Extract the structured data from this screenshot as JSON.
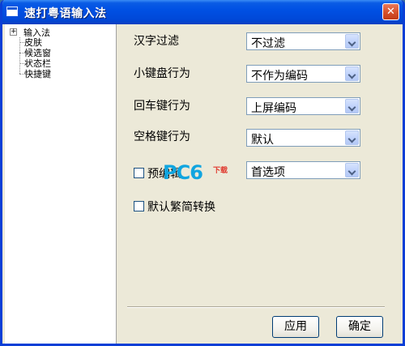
{
  "window": {
    "title": "速打粤语输入法",
    "close_glyph": "✕"
  },
  "tree": {
    "root": {
      "label": "输入法",
      "expander": "+"
    },
    "children": [
      "皮肤",
      "候选窗",
      "状态栏",
      "快捷键"
    ]
  },
  "settings": {
    "hanzi_filter": {
      "label": "汉字过滤",
      "value": "不过滤"
    },
    "keypad_behavior": {
      "label": "小键盘行为",
      "value": "不作为编码"
    },
    "enter_behavior": {
      "label": "回车键行为",
      "value": "上屏编码"
    },
    "space_behavior": {
      "label": "空格键行为",
      "value": "默认"
    },
    "preedit": {
      "label": "预编辑",
      "value": "首选项",
      "checked": false
    },
    "trad_simp": {
      "label": "默认繁简转换",
      "checked": false
    }
  },
  "watermark": {
    "text": "PC6",
    "sub": "下载"
  },
  "buttons": {
    "apply": "应用",
    "ok": "确定"
  }
}
